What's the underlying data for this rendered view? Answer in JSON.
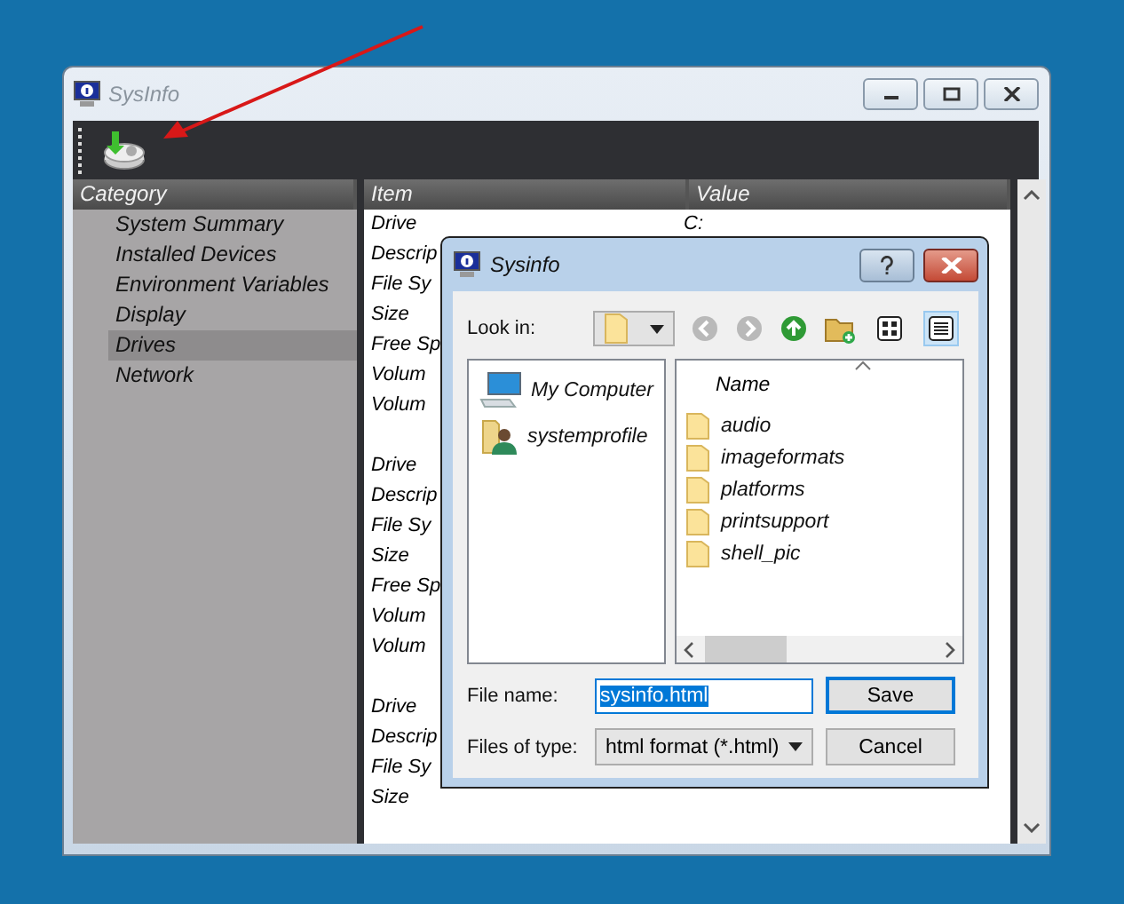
{
  "window": {
    "title": "SysInfo"
  },
  "category_panel": {
    "header": "Category",
    "items": [
      {
        "label": "System Summary",
        "selected": false
      },
      {
        "label": "Installed Devices",
        "selected": false
      },
      {
        "label": "Environment Variables",
        "selected": false
      },
      {
        "label": "Display",
        "selected": false
      },
      {
        "label": "Drives",
        "selected": true
      },
      {
        "label": "Network",
        "selected": false
      }
    ]
  },
  "details": {
    "columns": [
      "Item",
      "Value"
    ],
    "groups": [
      {
        "rows": [
          {
            "item": "Drive",
            "value": "C:"
          },
          {
            "item": "Descrip"
          },
          {
            "item": "File Sy"
          },
          {
            "item": "Size"
          },
          {
            "item": "Free Sp"
          },
          {
            "item": "Volum"
          },
          {
            "item": "Volum"
          }
        ]
      },
      {
        "rows": [
          {
            "item": "Drive"
          },
          {
            "item": "Descrip"
          },
          {
            "item": "File Sy"
          },
          {
            "item": "Size"
          },
          {
            "item": "Free Sp"
          },
          {
            "item": "Volum"
          },
          {
            "item": "Volum"
          }
        ]
      },
      {
        "rows": [
          {
            "item": "Drive"
          },
          {
            "item": "Descrip"
          },
          {
            "item": "File Sy"
          },
          {
            "item": "Size"
          }
        ]
      }
    ]
  },
  "save_dialog": {
    "title": "Sysinfo",
    "look_in_label": "Look in:",
    "view_modes": [
      {
        "kind": "icons",
        "selected": false
      },
      {
        "kind": "list",
        "selected": true
      }
    ],
    "places": [
      {
        "kind": "computer",
        "label": "My Computer"
      },
      {
        "kind": "user",
        "label": "systemprofile"
      }
    ],
    "files_header": "Name",
    "files": [
      "audio",
      "imageformats",
      "platforms",
      "printsupport",
      "shell_pic"
    ],
    "file_name_label": "File name:",
    "file_name": "sysinfo.html",
    "file_type_label": "Files of type:",
    "file_type": "html format (*.html)",
    "buttons": [
      {
        "label": "Save",
        "default": true
      },
      {
        "label": "Cancel",
        "default": false
      }
    ]
  }
}
